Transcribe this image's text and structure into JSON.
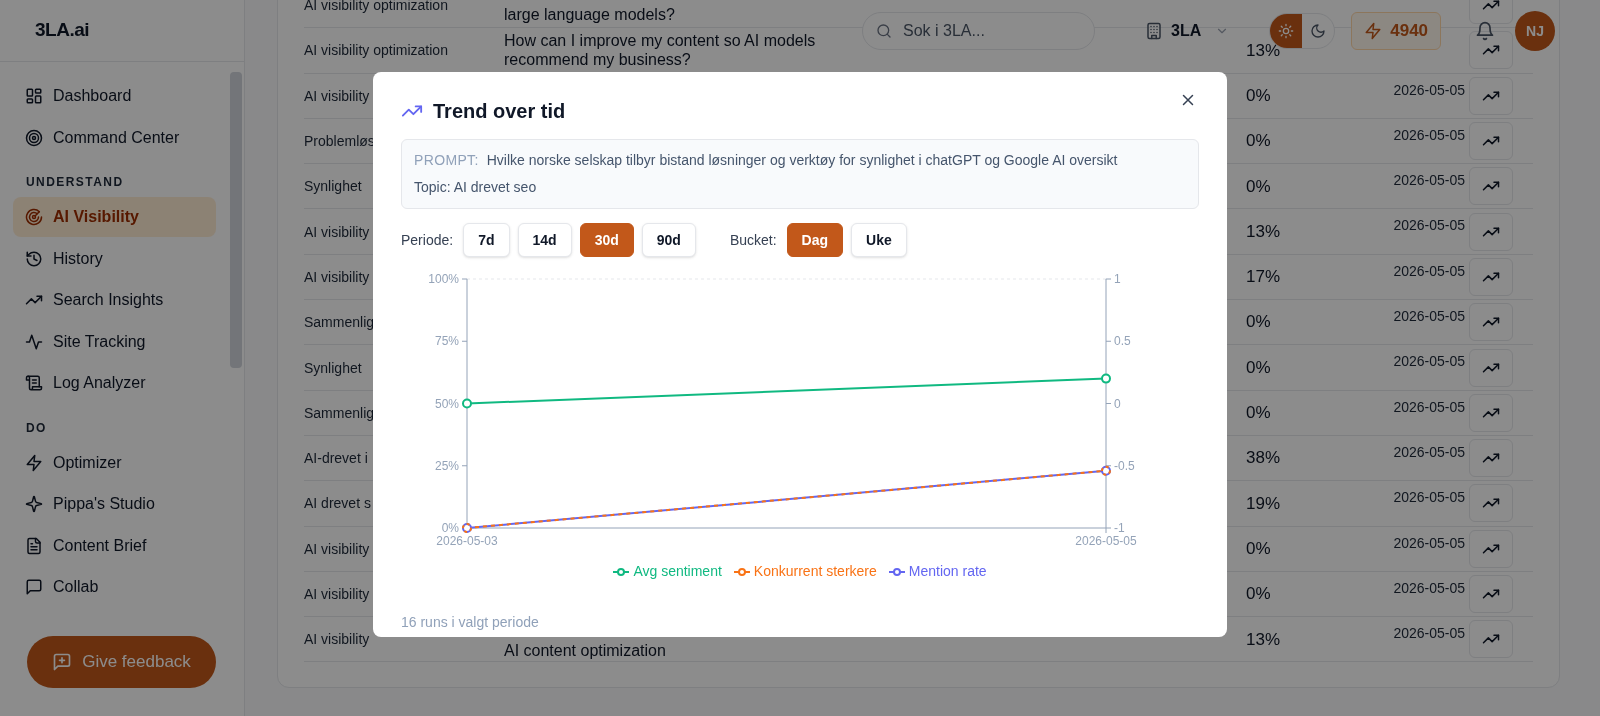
{
  "sidebar": {
    "logo": "3LA.ai",
    "sections": [
      {
        "items": [
          {
            "label": "Dashboard",
            "selected": false
          },
          {
            "label": "Command Center",
            "selected": false
          }
        ]
      },
      {
        "heading": "UNDERSTAND",
        "items": [
          {
            "label": "AI Visibility",
            "selected": true
          },
          {
            "label": "History",
            "selected": false
          },
          {
            "label": "Search Insights",
            "selected": false
          },
          {
            "label": "Site Tracking",
            "selected": false
          },
          {
            "label": "Log Analyzer",
            "selected": false
          }
        ]
      },
      {
        "heading": "DO",
        "items": [
          {
            "label": "Optimizer",
            "selected": false
          },
          {
            "label": "Pippa's Studio",
            "selected": false
          },
          {
            "label": "Content Brief",
            "selected": false
          },
          {
            "label": "Collab",
            "selected": false
          }
        ]
      }
    ]
  },
  "header": {
    "search": {
      "placeholder": "Sok i 3LA..."
    },
    "workspace": "3LA",
    "theme": [
      {
        "kind": "sun",
        "selected": true
      },
      {
        "kind": "moon",
        "selected": false
      }
    ],
    "credits": "4940",
    "avatar": "NJ"
  },
  "table": {
    "rows": [
      {
        "topic": "AI visibility optimization",
        "prompt": "large language models?"
      },
      {
        "topic": "AI visibility optimization",
        "prompt": "How can I improve my content so AI models recommend my business?",
        "rate": "13%"
      },
      {
        "topic": "AI visibility",
        "rate": "0%",
        "date": "2026-05-05"
      },
      {
        "topic": "Problemløs",
        "rate": "0%",
        "date": "2026-05-05"
      },
      {
        "topic": "Synlighet",
        "rate": "0%",
        "date": "2026-05-05"
      },
      {
        "topic": "AI visibility",
        "rate": "13%",
        "date": "2026-05-05"
      },
      {
        "topic": "AI visibility",
        "rate": "17%",
        "date": "2026-05-05"
      },
      {
        "topic": "Sammenlig",
        "rate": "0%",
        "date": "2026-05-05"
      },
      {
        "topic": "Synlighet",
        "rate": "0%",
        "date": "2026-05-05"
      },
      {
        "topic": "Sammenlig",
        "rate": "0%",
        "date": "2026-05-05"
      },
      {
        "topic": "AI-drevet i",
        "rate": "38%",
        "date": "2026-05-05"
      },
      {
        "topic": "AI drevet s",
        "rate": "19%",
        "date": "2026-05-05"
      },
      {
        "topic": "AI visibility",
        "rate": "0%",
        "date": "2026-05-05"
      },
      {
        "topic": "AI visibility",
        "rate": "0%",
        "date": "2026-05-05"
      },
      {
        "topic": "AI visibility",
        "prompt": "AI content optimization",
        "rate": "13%",
        "date": "2026-05-05"
      }
    ]
  },
  "feedback_button": "Give feedback",
  "modal": {
    "title": "Trend over tid",
    "prompt_label": "PROMPT:",
    "prompt": "Hvilke norske selskap tilbyr bistand løsninger og verktøy for synlighet i chatGPT og Google AI oversikt",
    "topic": "Topic: AI drevet seo",
    "period_label": "Periode:",
    "periods": [
      {
        "label": "7d",
        "selected": false
      },
      {
        "label": "14d",
        "selected": false
      },
      {
        "label": "30d",
        "selected": true
      },
      {
        "label": "90d",
        "selected": false
      }
    ],
    "bucket_label": "Bucket:",
    "buckets": [
      {
        "label": "Dag",
        "selected": true
      },
      {
        "label": "Uke",
        "selected": false
      }
    ],
    "chart_data": {
      "type": "line",
      "categories": [
        "2026-05-03",
        "2026-05-05"
      ],
      "ylim": [
        0,
        100
      ],
      "y2lim": [
        -1,
        1
      ],
      "yticks": [
        {
          "value": 0,
          "label": "0%"
        },
        {
          "value": 25,
          "label": "25%"
        },
        {
          "value": 50,
          "label": "50%"
        },
        {
          "value": 75,
          "label": "75%"
        },
        {
          "value": 100,
          "label": "100%"
        }
      ],
      "y2ticks": [
        {
          "value": -1,
          "label": "-1"
        },
        {
          "value": -0.5,
          "label": "-0.5"
        },
        {
          "value": 0,
          "label": "0"
        },
        {
          "value": 0.5,
          "label": "0.5"
        },
        {
          "value": 1,
          "label": "1"
        }
      ],
      "series": [
        {
          "name": "Avg sentiment",
          "color": "#10b981",
          "axis": "y2",
          "marker": "circle",
          "values": [
            0,
            0.2
          ]
        },
        {
          "name": "Konkurrent sterkere",
          "color": "#f97316",
          "line_style": "dashed",
          "marker": "circle",
          "values": [
            0,
            23
          ]
        },
        {
          "name": "Mention rate",
          "color": "#6366f1",
          "marker": "circle",
          "values": [
            0,
            23
          ]
        }
      ]
    },
    "footer": "16 runs i valgt periode"
  }
}
